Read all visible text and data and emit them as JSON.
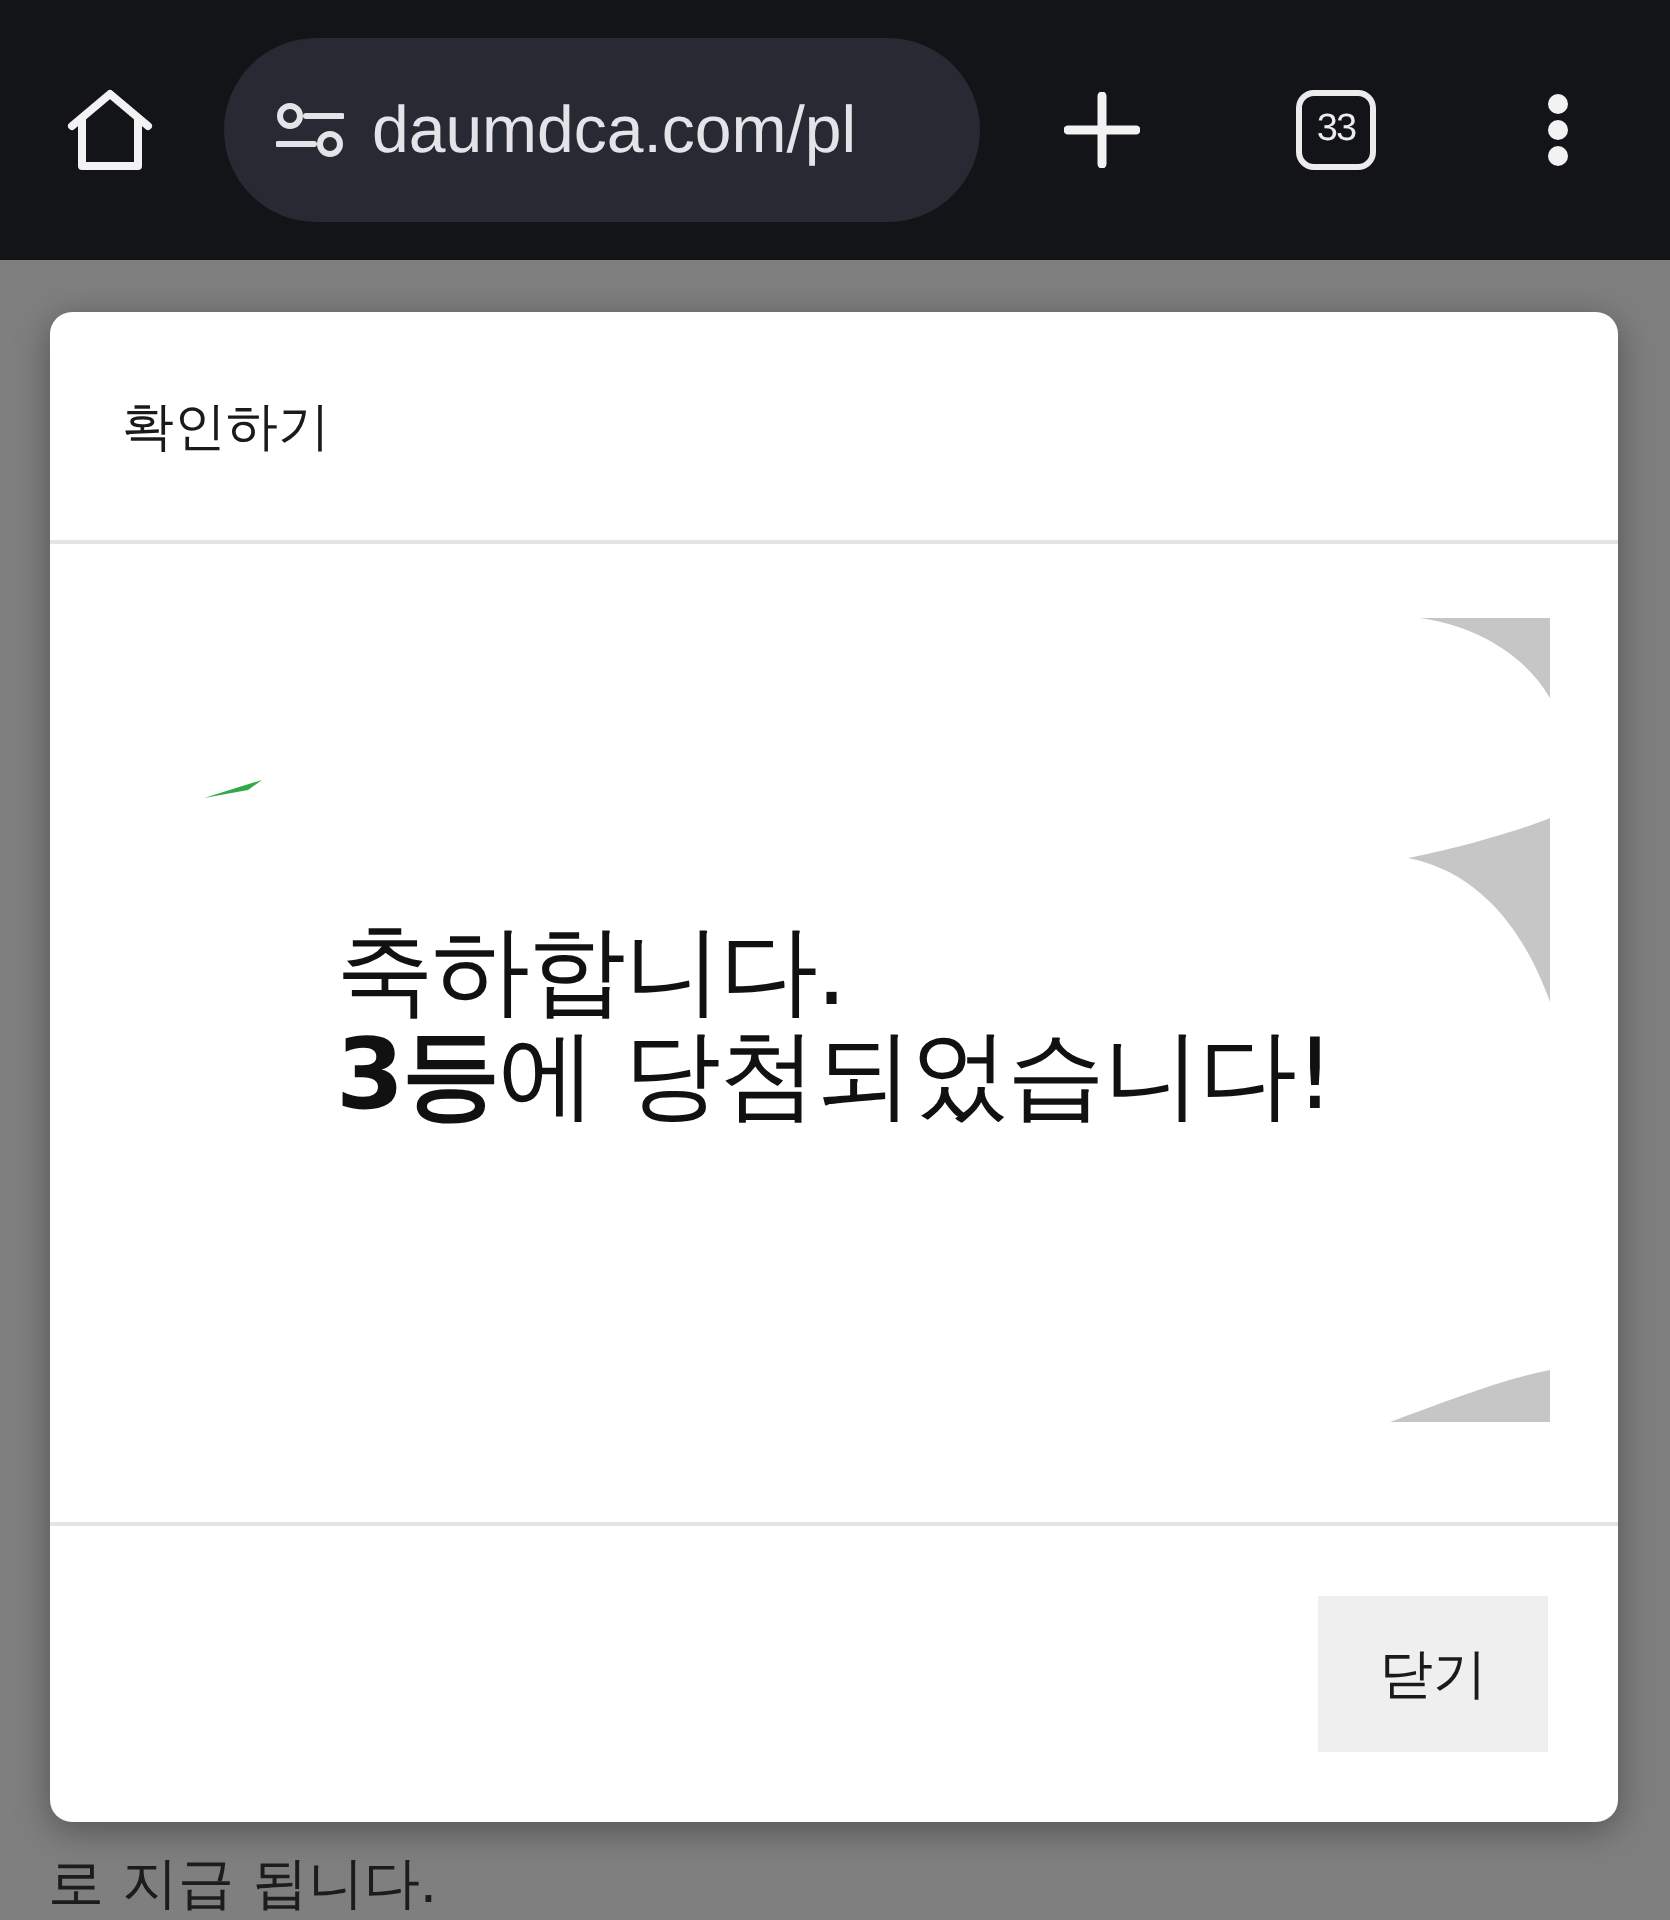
{
  "browser": {
    "url": "daumdca.com/pl",
    "tab_count": "33"
  },
  "dialog": {
    "title": "확인하기",
    "message_lines": [
      "축하합니다.",
      "**3등**에 당첨되었습니다!"
    ],
    "close_button": {
      "label": "닫기"
    }
  },
  "page": {
    "text": "로 지급 됩니다."
  }
}
